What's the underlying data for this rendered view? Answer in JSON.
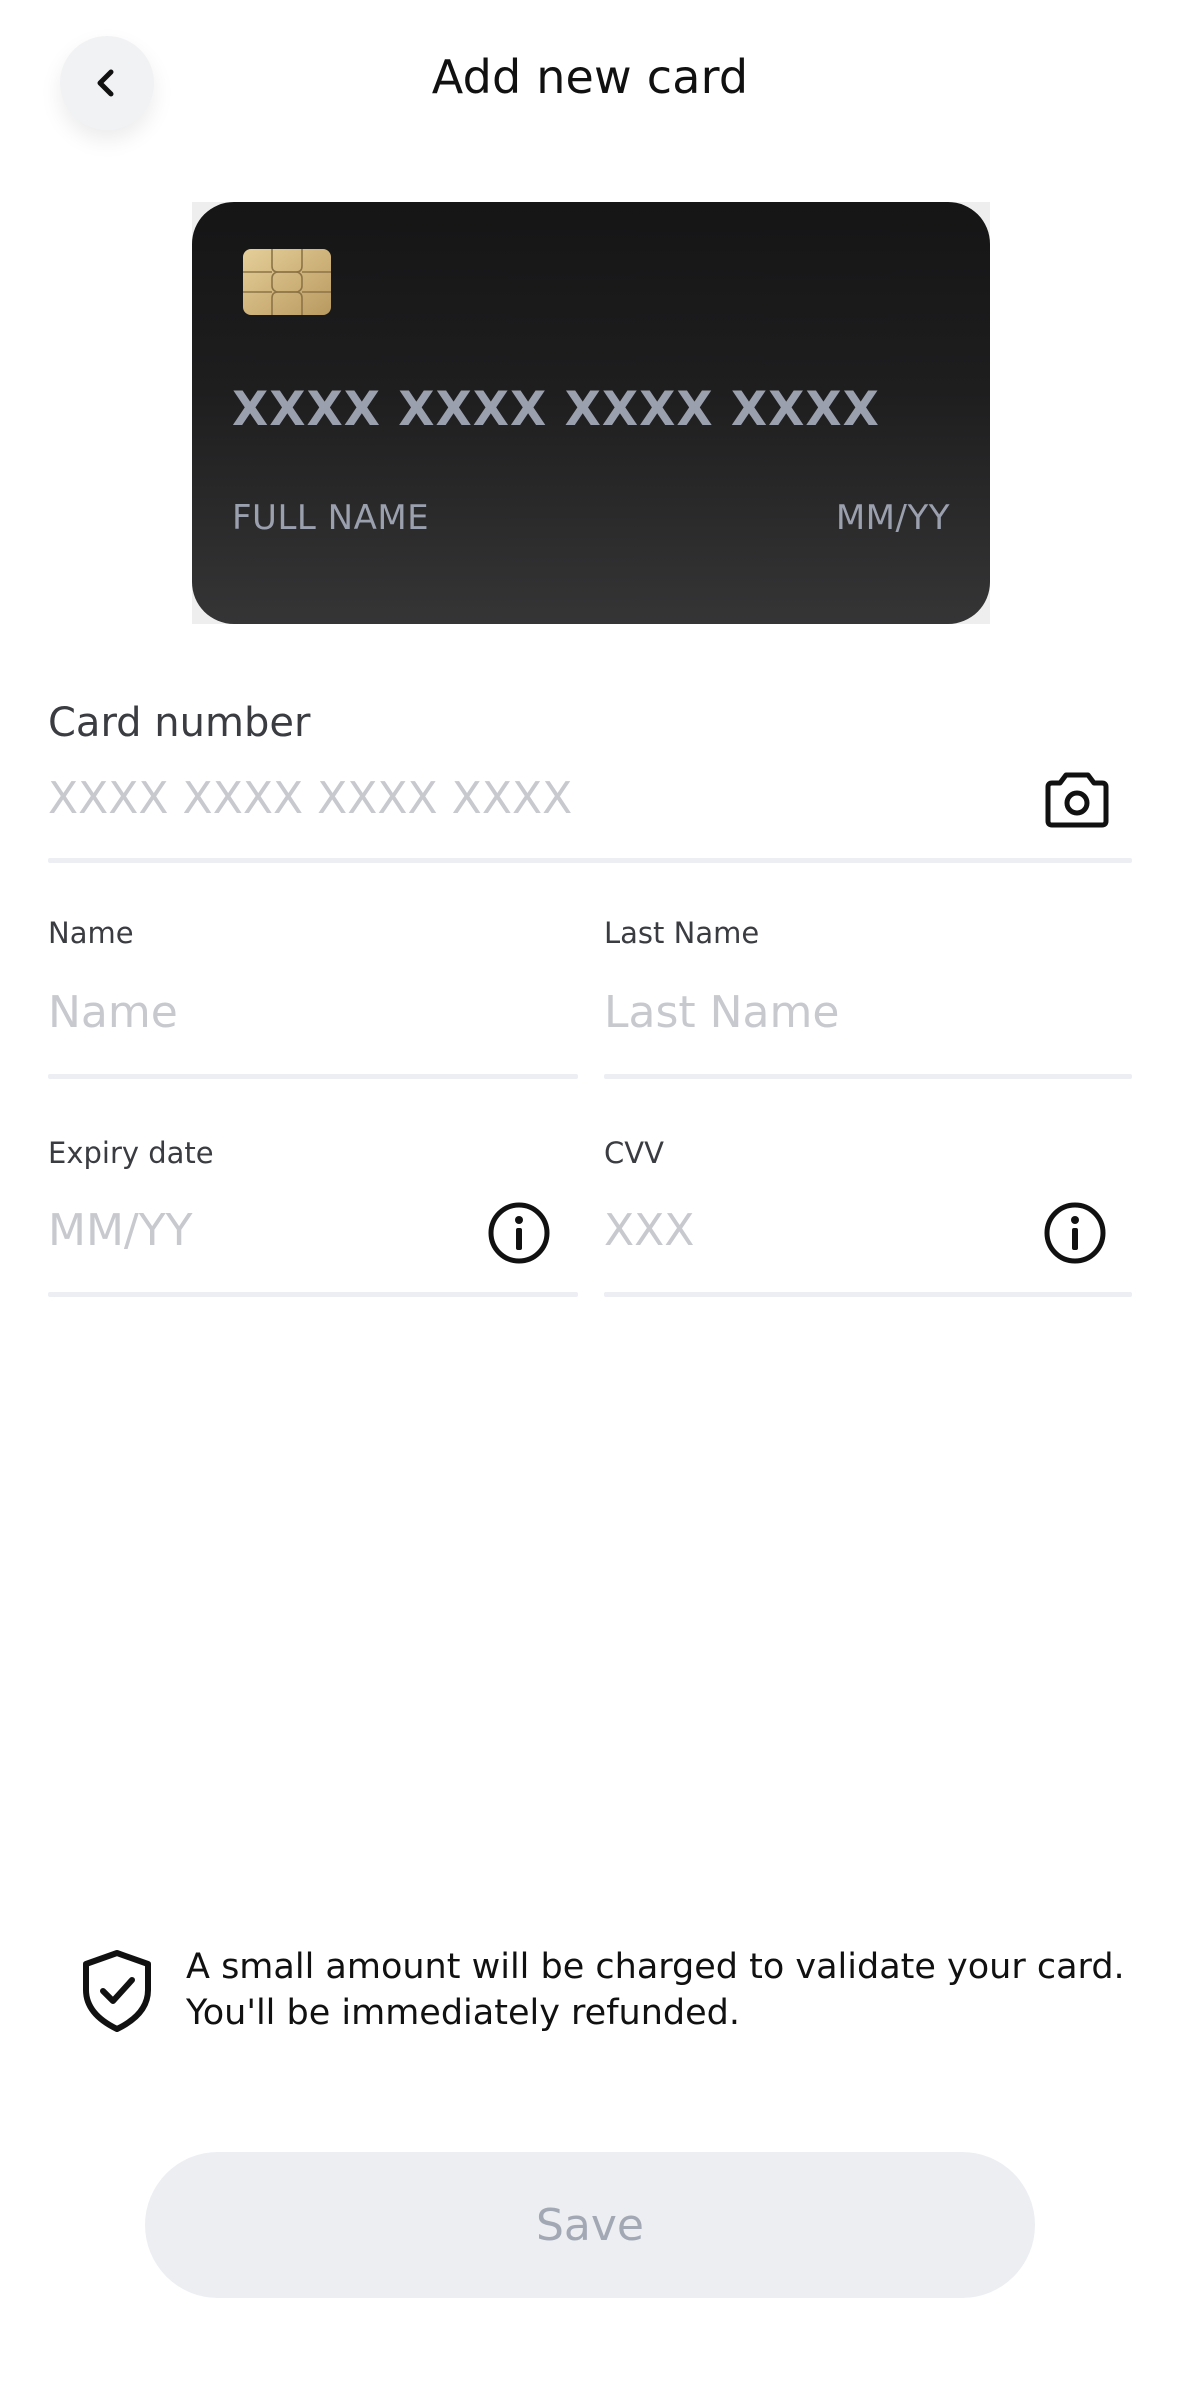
{
  "header": {
    "title": "Add new card",
    "back_icon": "chevron-left-icon"
  },
  "card_preview": {
    "number": "XXXX XXXX XXXX XXXX",
    "name": "FULL NAME",
    "expiry": "MM/YY",
    "chip_icon": "chip-icon"
  },
  "form": {
    "card_number": {
      "label": "Card number",
      "placeholder": "XXXX XXXX XXXX XXXX",
      "value": "",
      "icon": "camera-icon"
    },
    "first_name": {
      "label": "Name",
      "placeholder": "Name",
      "value": ""
    },
    "last_name": {
      "label": "Last Name",
      "placeholder": "Last Name",
      "value": ""
    },
    "expiry": {
      "label": "Expiry date",
      "placeholder": "MM/YY",
      "value": "",
      "icon": "info-icon"
    },
    "cvv": {
      "label": "CVV",
      "placeholder": "XXX",
      "value": "",
      "icon": "info-icon"
    }
  },
  "notice": {
    "icon": "shield-check-icon",
    "line1": "A small amount will be charged to validate your card.",
    "line2": "You'll be immediately refunded."
  },
  "actions": {
    "save_label": "Save"
  }
}
